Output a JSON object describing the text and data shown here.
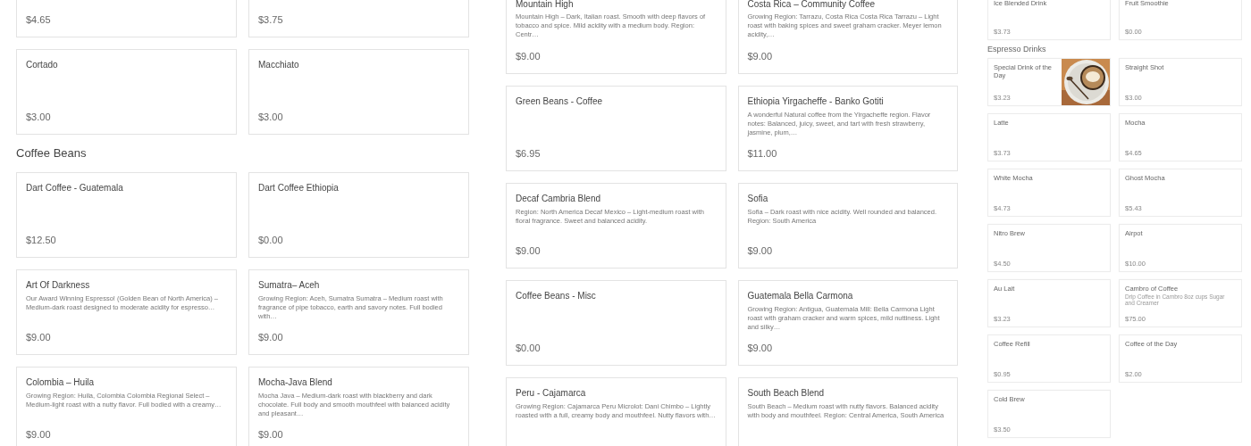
{
  "panels": [
    {
      "sections": [
        {
          "items": [
            {
              "price": "$4.65"
            },
            {
              "price": "$3.75"
            },
            {
              "name": "Cortado",
              "price": "$3.00"
            },
            {
              "name": "Macchiato",
              "price": "$3.00"
            }
          ]
        },
        {
          "heading": "Coffee Beans",
          "items": [
            {
              "name": "Dart Coffee - Guatemala",
              "price": "$12.50"
            },
            {
              "name": "Dart Coffee Ethiopia",
              "price": "$0.00"
            },
            {
              "name": "Art Of Darkness",
              "description": "Our Award Winning Espresso! (Golden Bean of North America) – Medium-dark roast designed to moderate acidity for espresso…",
              "price": "$9.00"
            },
            {
              "name": "Sumatra– Aceh",
              "description": "Growing Region: Aceh, Sumatra Sumatra – Medium roast with fragrance of pipe tobacco, earth and savory notes. Full bodied with…",
              "price": "$9.00"
            },
            {
              "name": "Colombia – Huila",
              "description": "Growing Region: Huila, Colombia Colombia Regional Select – Medium-light roast with a nutty flavor. Full bodied with a creamy…",
              "price": "$9.00"
            },
            {
              "name": "Mocha-Java Blend",
              "description": "Mocha Java – Medium-dark roast with blackberry and dark chocolate. Full body and smooth mouthfeel with balanced acidity and pleasant…",
              "price": "$9.00"
            }
          ]
        }
      ]
    },
    {
      "sections": [
        {
          "items": [
            {
              "name": "Mountain High",
              "description": "Mountain High – Dark, Italian roast. Smooth with deep flavors of tobacco and spice. Mild acidity with a medium body. Region: Centr…",
              "price": "$9.00"
            },
            {
              "name": "Costa Rica – Community Coffee",
              "description": "Growing Region: Tarrazu, Costa Rica Costa Rica Tarrazu – Light roast with baking spices and sweet graham cracker. Meyer lemon acidity,…",
              "price": "$9.00"
            },
            {
              "name": "Green Beans - Coffee",
              "price": "$6.95"
            },
            {
              "name": "Ethiopia Yirgacheffe - Banko Gotiti",
              "description": "A wonderful Natural coffee from the Yirgacheffe region. Flavor notes: Balanced, juicy, sweet, and tart with fresh strawberry, jasmine, plum,…",
              "price": "$11.00"
            },
            {
              "name": "Decaf Cambria Blend",
              "description": "Region: North America Decaf Mexico – Light-medium roast with floral fragrance. Sweet and balanced acidity.",
              "price": "$9.00"
            },
            {
              "name": "Sofia",
              "description": "Sofia – Dark roast with nice acidity. Well rounded and balanced. Region: South America",
              "price": "$9.00"
            },
            {
              "name": "Coffee Beans - Misc",
              "price": "$0.00"
            },
            {
              "name": "Guatemala Bella Carmona",
              "description": "Growing Region: Antigua, Guatemala Mill: Bella Carmona Light roast with graham cracker and warm spices, mild nuttiness. Light and silky…",
              "price": "$9.00"
            },
            {
              "name": "Peru - Cajamarca",
              "description": "Growing Region: Cajamarca Peru Microlot: Dani Chimbo – Lightly roasted with a full, creamy body and mouthfeel. Nutty flavors with…"
            },
            {
              "name": "South Beach Blend",
              "description": "South Beach – Medium roast with nutty flavors. Balanced acidity with body and mouthfeel. Region: Central America, South America"
            }
          ]
        }
      ]
    },
    {
      "sections": [
        {
          "items": [
            {
              "name": "Ice Blended Drink",
              "price": "$3.73"
            },
            {
              "name": "Fruit Smoothie",
              "price": "$0.00"
            }
          ]
        },
        {
          "heading": "Espresso Drinks",
          "items": [
            {
              "name": "Special Drink of the Day",
              "price": "$3.23",
              "kind": "picture"
            },
            {
              "name": "Straight Shot",
              "price": "$3.00"
            },
            {
              "name": "Latte",
              "price": "$3.73"
            },
            {
              "name": "Mocha",
              "price": "$4.65"
            },
            {
              "name": "White Mocha",
              "price": "$4.73"
            },
            {
              "name": "Ghost Mocha",
              "price": "$5.43"
            },
            {
              "name": "Nitro Brew",
              "price": "$4.50"
            },
            {
              "name": "Airpot",
              "price": "$10.00"
            },
            {
              "name": "Au Lait",
              "price": "$3.23"
            },
            {
              "name": "Cambro of Coffee",
              "description": "Drip Coffee in Cambro 8oz cups Sugar and Creamer",
              "price": "$75.00"
            },
            {
              "name": "Coffee Refill",
              "price": "$0.95"
            },
            {
              "name": "Coffee of the Day",
              "price": "$2.00"
            },
            {
              "name": "Cold Brew",
              "price": "$3.50"
            }
          ]
        }
      ]
    }
  ]
}
